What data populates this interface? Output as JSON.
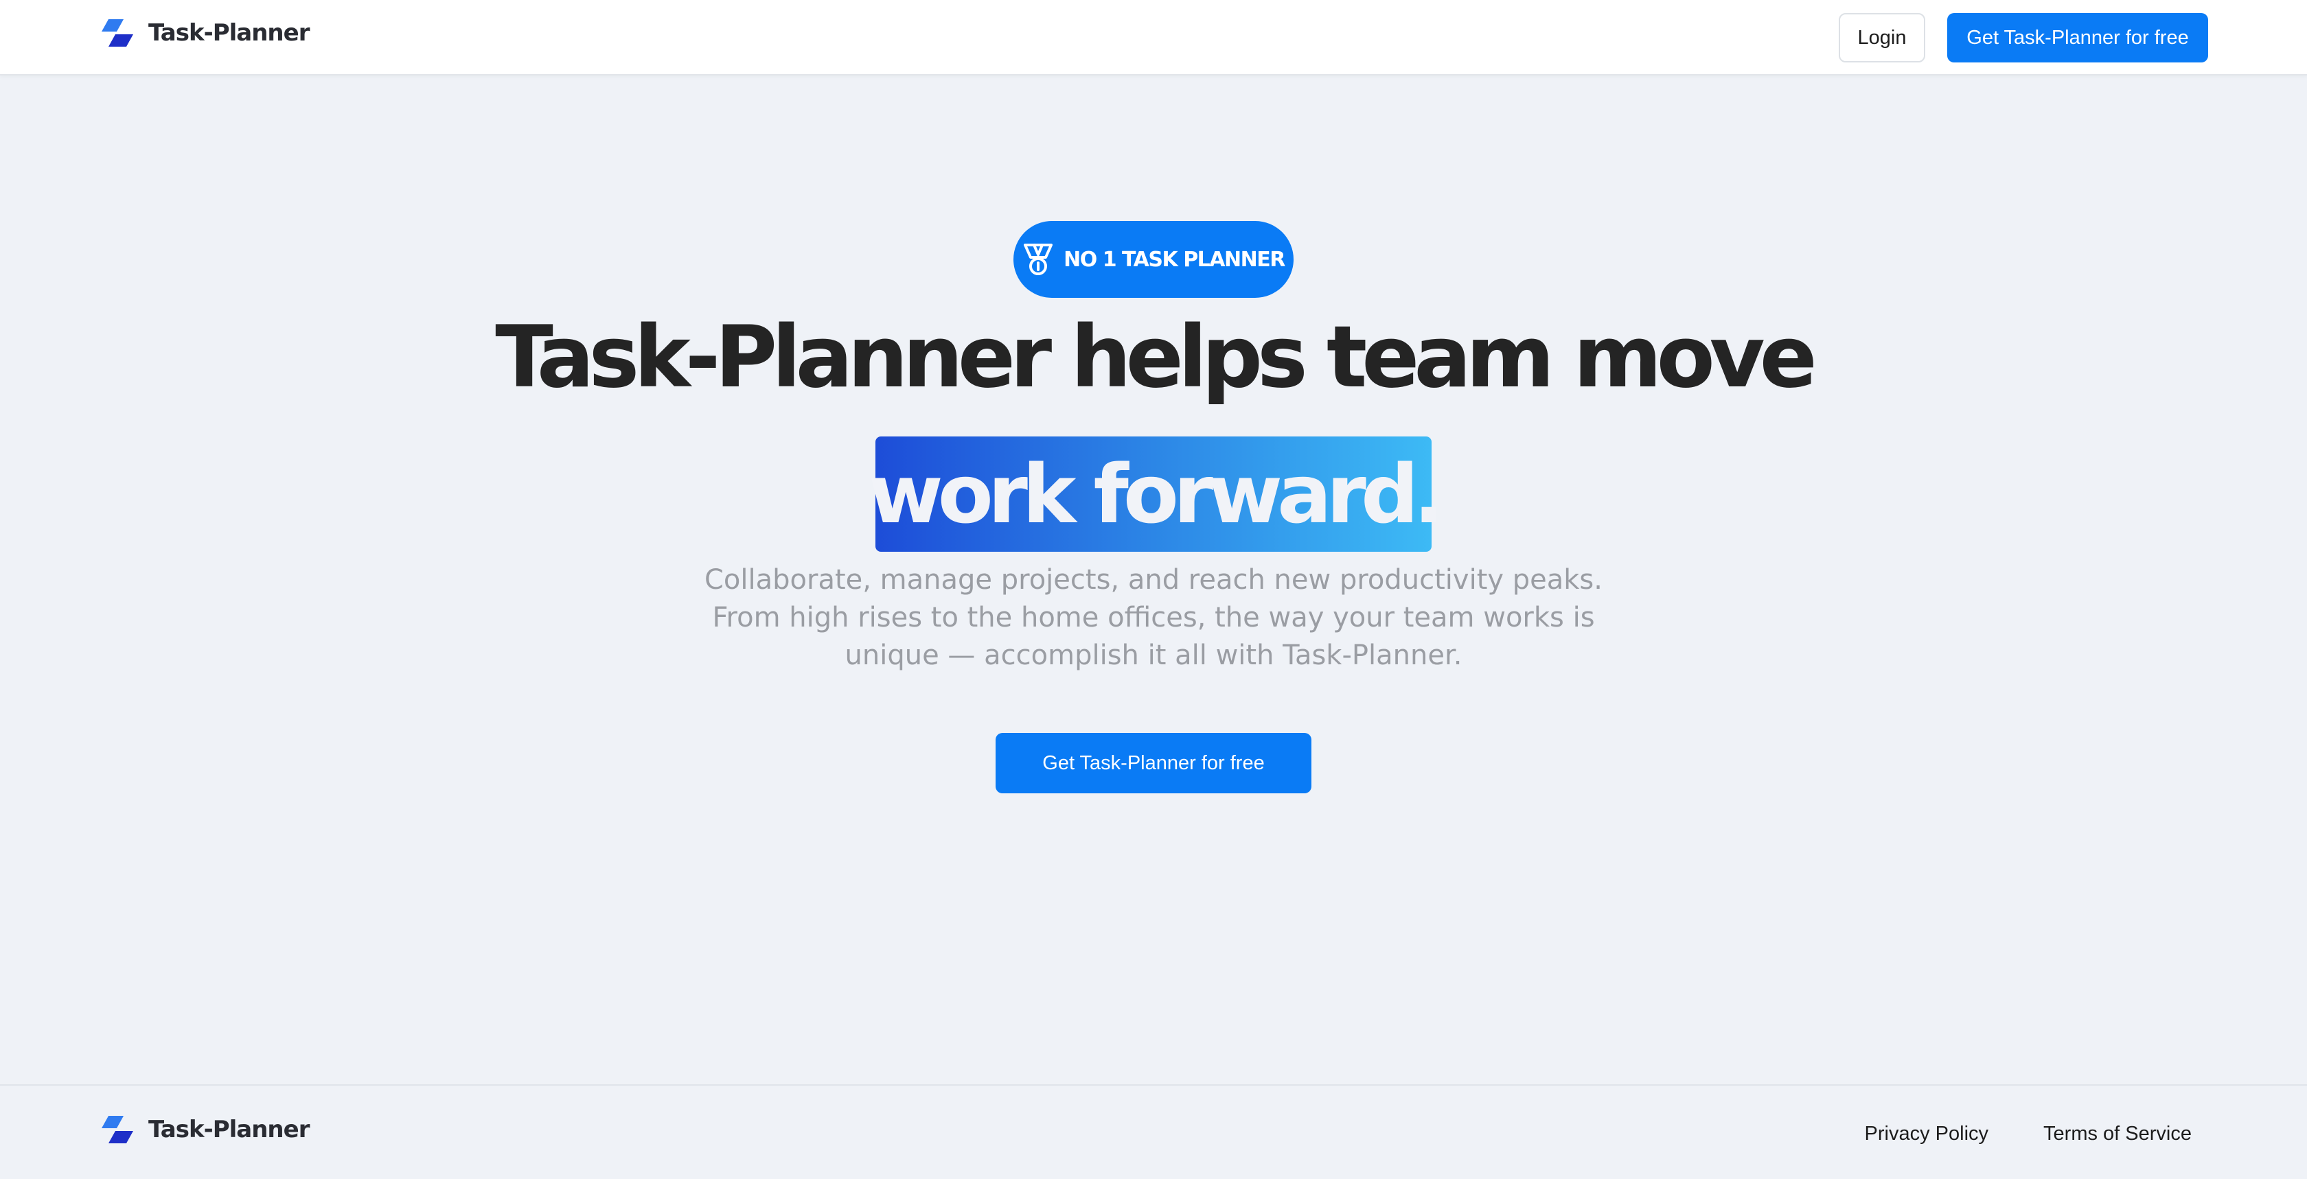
{
  "header": {
    "brand_name": "Task-Planner",
    "login_label": "Login",
    "cta_label": "Get Task-Planner for free"
  },
  "hero": {
    "badge_label": "NO 1 TASK PLANNER",
    "headline": "Task-Planner helps team move",
    "highlight": "work forward.",
    "subtitle_lines": [
      "Collaborate, manage projects, and reach new productivity peaks.",
      "From high rises to the home offices, the way your team works is",
      "unique — accomplish it all with Task-Planner."
    ],
    "cta_label": "Get Task-Planner for free"
  },
  "footer": {
    "brand_name": "Task-Planner",
    "links": [
      "Privacy Policy",
      "Terms of Service"
    ]
  },
  "icons": {
    "logo": "logo-icon",
    "badge": "medal-icon"
  },
  "colors": {
    "accent": "#0A7BF5",
    "background": "#EFF2F7",
    "logo_dark": "#1E2FC8",
    "logo_light": "#2F7BF0",
    "gradient_start": "#1D4DD8",
    "gradient_end": "#3DBAF5"
  }
}
